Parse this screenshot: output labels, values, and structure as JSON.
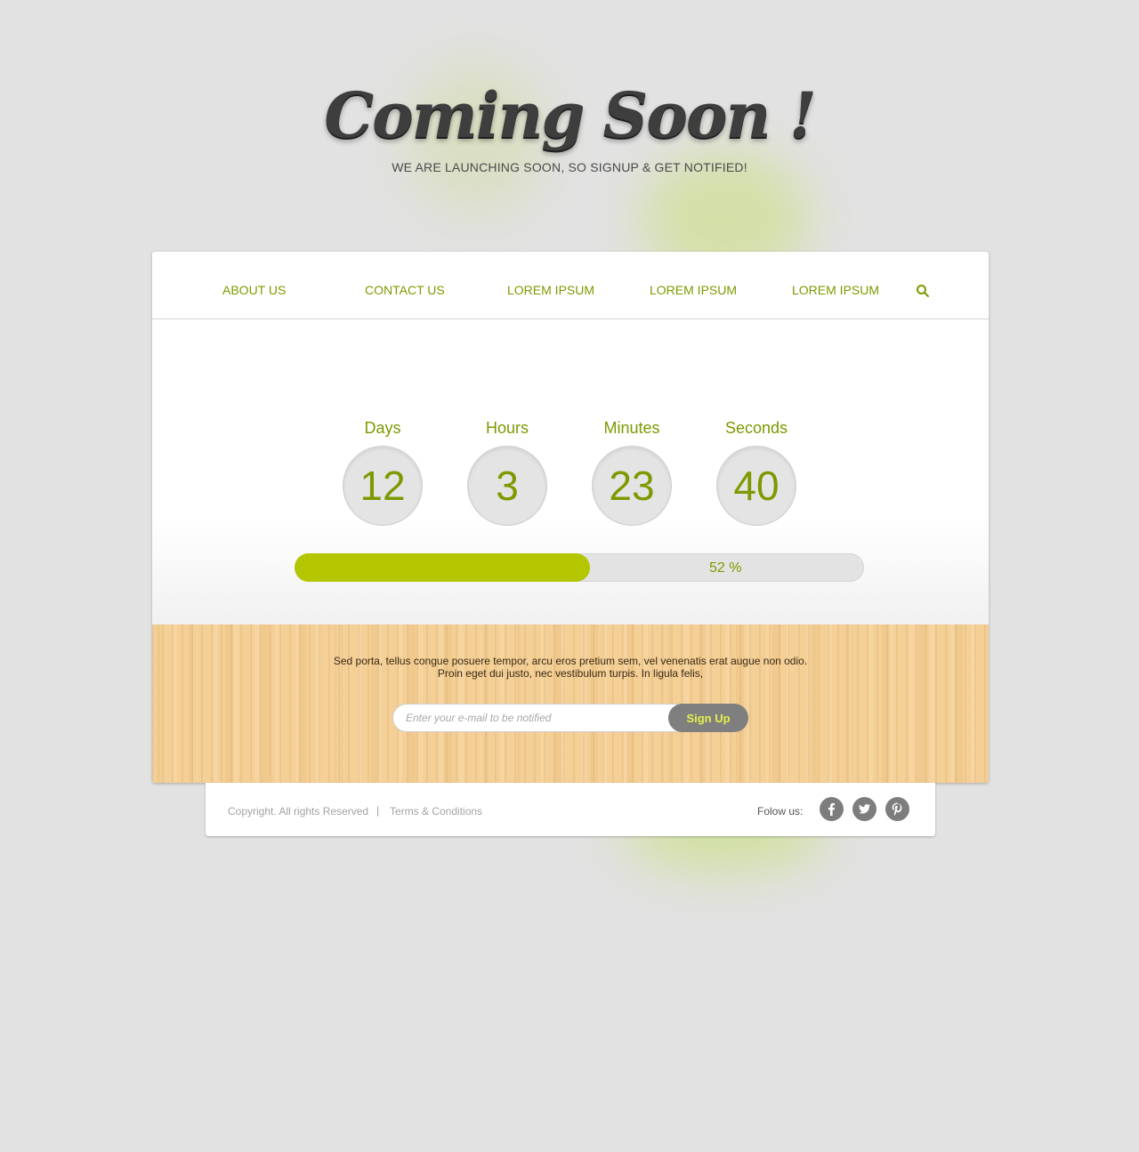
{
  "hero": {
    "title": "Coming Soon !",
    "subtitle": "WE ARE LAUNCHING SOON, SO SIGNUP & GET NOTIFIED!"
  },
  "nav": {
    "items": [
      {
        "label": "ABOUT US"
      },
      {
        "label": "CONTACT US"
      },
      {
        "label": "LOREM IPSUM"
      },
      {
        "label": "LOREM IPSUM"
      },
      {
        "label": "LOREM IPSUM"
      }
    ],
    "search_icon": "search-icon"
  },
  "countdown": {
    "units": [
      {
        "label": "Days",
        "value": "12"
      },
      {
        "label": "Hours",
        "value": "3"
      },
      {
        "label": "Minutes",
        "value": "23"
      },
      {
        "label": "Seconds",
        "value": "40"
      }
    ]
  },
  "progress": {
    "percent": 52,
    "label": "52 %"
  },
  "signup": {
    "text_line1": "Sed porta, tellus congue posuere tempor, arcu eros pretium sem, vel venenatis erat augue non odio.",
    "text_line2": "Proin eget dui justo, nec vestibulum turpis. In ligula felis,",
    "email_placeholder": "Enter your e-mail to be notified",
    "button_label": "Sign Up"
  },
  "footer": {
    "copyright": "Copyright. All rights Reserved",
    "separator": "|",
    "terms": "Terms & Conditions",
    "follow_label": "Folow us:",
    "social": [
      "facebook-icon",
      "twitter-icon",
      "pinterest-icon"
    ]
  },
  "colors": {
    "accent": "#7c9a00",
    "progress_fill": "#b3c600",
    "page_bg": "#e2e2e2",
    "wood": "#f4cf96"
  }
}
